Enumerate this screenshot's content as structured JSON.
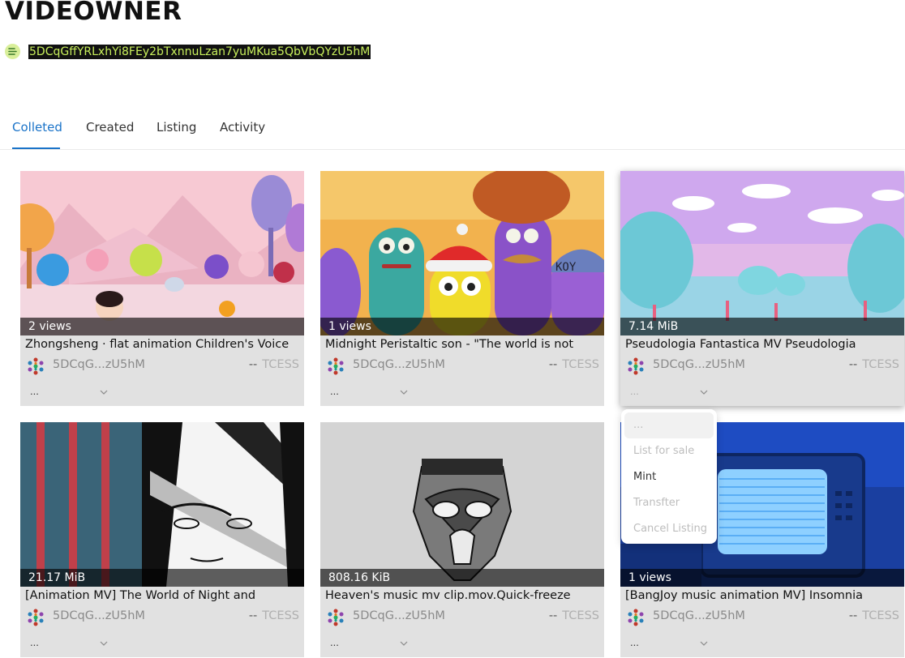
{
  "header": {
    "title": "VIDEOWNER",
    "address": "5DCqGffYRLxhYi8FEy2bTxnnuLzan7yuMKua5QbVbQYzU5hM"
  },
  "tabs": [
    {
      "label": "Colleted",
      "active": true
    },
    {
      "label": "Created",
      "active": false
    },
    {
      "label": "Listing",
      "active": false
    },
    {
      "label": "Activity",
      "active": false
    }
  ],
  "cards": [
    {
      "badge": "2 views",
      "title": "Zhongsheng · flat animation Children's Voice",
      "owner": "5DCqG...zU5hM",
      "price_dash": "--",
      "currency": "TCESS",
      "more": "...",
      "thumb": "children-animation"
    },
    {
      "badge": "1 views",
      "title": "Midnight Peristaltic son - \"The world is not",
      "owner": "5DCqG...zU5hM",
      "price_dash": "--",
      "currency": "TCESS",
      "more": "...",
      "thumb": "cartoon-characters"
    },
    {
      "badge": "7.14 MiB",
      "title": "Pseudologia Fantastica MV Pseudologia",
      "owner": "5DCqG...zU5hM",
      "price_dash": "--",
      "currency": "TCESS",
      "more": "...",
      "thumb": "pastel-landscape"
    },
    {
      "badge": "21.17 MiB",
      "title": "[Animation MV] The World of Night and",
      "owner": "5DCqG...zU5hM",
      "price_dash": "--",
      "currency": "TCESS",
      "more": "...",
      "thumb": "manga-portrait"
    },
    {
      "badge": "808.16 KiB",
      "title": "Heaven's music mv clip.mov.Quick-freeze",
      "owner": "5DCqG...zU5hM",
      "price_dash": "--",
      "currency": "TCESS",
      "more": "...",
      "thumb": "masked-face"
    },
    {
      "badge": "1 views",
      "title": "[BangJoy music animation MV] Insomnia",
      "owner": "5DCqG...zU5hM",
      "price_dash": "--",
      "currency": "TCESS",
      "more": "...",
      "thumb": "retro-monitor"
    }
  ],
  "menu": {
    "items": [
      "...",
      "List for sale",
      "Mint",
      "Transfter",
      "Cancel Listing"
    ]
  },
  "colors": {
    "accent": "#1a73c8",
    "address_bg": "#111111",
    "address_text": "#c8ef5c",
    "card_bg": "#e1e1e1"
  }
}
